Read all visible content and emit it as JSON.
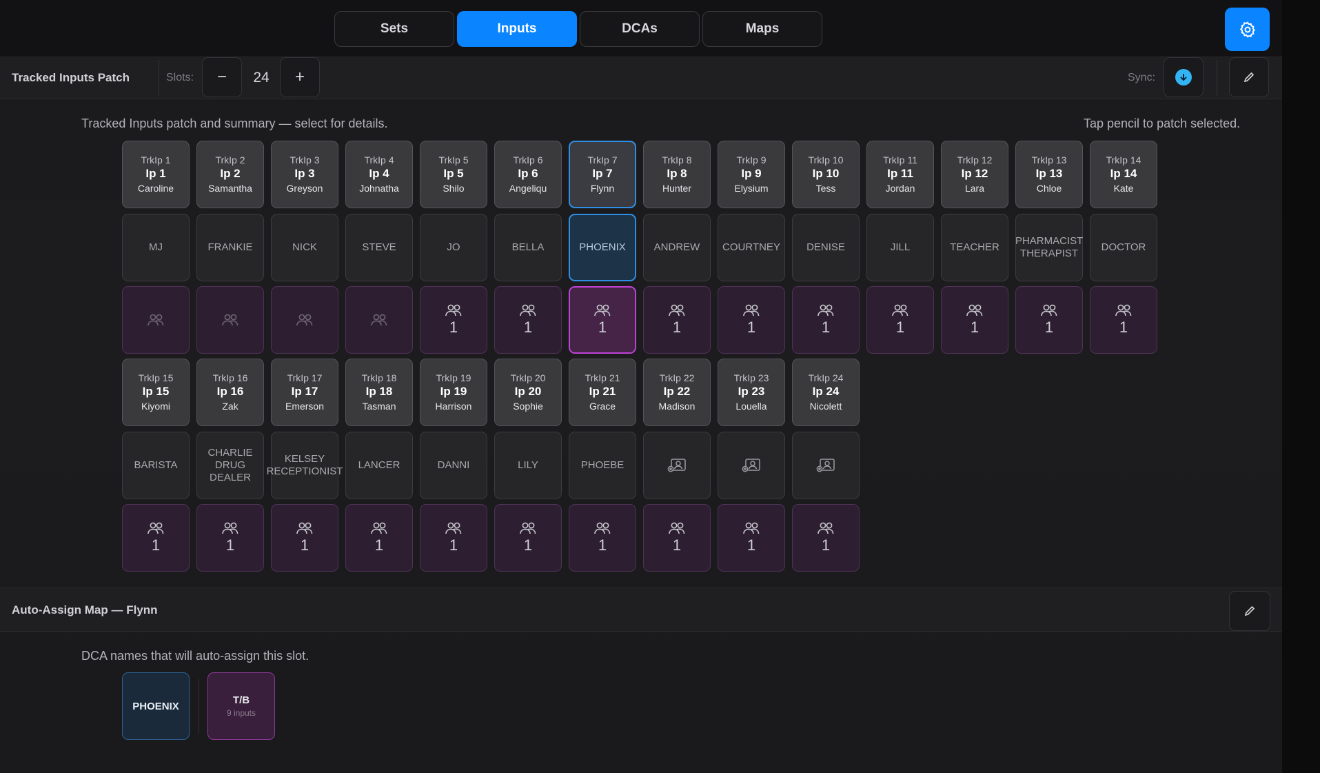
{
  "tabs": [
    {
      "label": "Sets",
      "active": false
    },
    {
      "label": "Inputs",
      "active": true
    },
    {
      "label": "DCAs",
      "active": false
    },
    {
      "label": "Maps",
      "active": false
    }
  ],
  "toolbar": {
    "title": "Tracked Inputs Patch",
    "slots_label": "Slots:",
    "minus": "−",
    "slots_value": "24",
    "plus": "+",
    "sync_label": "Sync:"
  },
  "patch": {
    "description": "Tracked Inputs patch and summary — select for details.",
    "hint": "Tap pencil to patch selected.",
    "slots": [
      {
        "trk": "TrkIp 1",
        "ip": "Ip 1",
        "who": "Caroline",
        "name": "MJ",
        "count": ""
      },
      {
        "trk": "TrkIp 2",
        "ip": "Ip 2",
        "who": "Samantha",
        "name": "FRANKIE",
        "count": ""
      },
      {
        "trk": "TrkIp 3",
        "ip": "Ip 3",
        "who": "Greyson",
        "name": "NICK",
        "count": ""
      },
      {
        "trk": "TrkIp 4",
        "ip": "Ip 4",
        "who": "Johnatha",
        "name": "STEVE",
        "count": ""
      },
      {
        "trk": "TrkIp 5",
        "ip": "Ip 5",
        "who": "Shilo",
        "name": "JO",
        "count": "1"
      },
      {
        "trk": "TrkIp 6",
        "ip": "Ip 6",
        "who": "Angeliqu",
        "name": "BELLA",
        "count": "1"
      },
      {
        "trk": "TrkIp 7",
        "ip": "Ip 7",
        "who": "Flynn",
        "name": "PHOENIX",
        "count": "1",
        "selected": true
      },
      {
        "trk": "TrkIp 8",
        "ip": "Ip 8",
        "who": "Hunter",
        "name": "ANDREW",
        "count": "1"
      },
      {
        "trk": "TrkIp 9",
        "ip": "Ip 9",
        "who": "Elysium",
        "name": "COURTNEY",
        "count": "1"
      },
      {
        "trk": "TrkIp 10",
        "ip": "Ip 10",
        "who": "Tess",
        "name": "DENISE",
        "count": "1"
      },
      {
        "trk": "TrkIp 11",
        "ip": "Ip 11",
        "who": "Jordan",
        "name": "JILL",
        "count": "1"
      },
      {
        "trk": "TrkIp 12",
        "ip": "Ip 12",
        "who": "Lara",
        "name": "TEACHER",
        "count": "1"
      },
      {
        "trk": "TrkIp 13",
        "ip": "Ip 13",
        "who": "Chloe",
        "name": "PHARMACIST THERAPIST",
        "count": "1"
      },
      {
        "trk": "TrkIp 14",
        "ip": "Ip 14",
        "who": "Kate",
        "name": "DOCTOR",
        "count": "1"
      },
      {
        "trk": "TrkIp 15",
        "ip": "Ip 15",
        "who": "Kiyomi",
        "name": "BARISTA",
        "count": "1"
      },
      {
        "trk": "TrkIp 16",
        "ip": "Ip 16",
        "who": "Zak",
        "name": "CHARLIE DRUG DEALER",
        "count": "1"
      },
      {
        "trk": "TrkIp 17",
        "ip": "Ip 17",
        "who": "Emerson",
        "name": "KELSEY RECEPTIONIST",
        "count": "1"
      },
      {
        "trk": "TrkIp 18",
        "ip": "Ip 18",
        "who": "Tasman",
        "name": "LANCER",
        "count": "1"
      },
      {
        "trk": "TrkIp 19",
        "ip": "Ip 19",
        "who": "Harrison",
        "name": "DANNI",
        "count": "1"
      },
      {
        "trk": "TrkIp 20",
        "ip": "Ip 20",
        "who": "Sophie",
        "name": "LILY",
        "count": "1"
      },
      {
        "trk": "TrkIp 21",
        "ip": "Ip 21",
        "who": "Grace",
        "name": "PHOEBE",
        "count": "1"
      },
      {
        "trk": "TrkIp 22",
        "ip": "Ip 22",
        "who": "Madison",
        "name": "",
        "count": "1"
      },
      {
        "trk": "TrkIp 23",
        "ip": "Ip 23",
        "who": "Louella",
        "name": "",
        "count": "1"
      },
      {
        "trk": "TrkIp 24",
        "ip": "Ip 24",
        "who": "Nicolett",
        "name": "",
        "count": "1"
      }
    ]
  },
  "auto_assign": {
    "title": "Auto-Assign Map — Flynn",
    "description": "DCA names that will auto-assign this slot.",
    "dca_phoenix": "PHOENIX",
    "dca_tb_name": "T/B",
    "dca_tb_sub": "9 inputs"
  },
  "colors": {
    "accent": "#0a84ff",
    "selected_pink": "#c043d6",
    "sync": "#33b4f5"
  },
  "icons": {
    "settings": "gear-icon",
    "sync": "download-circle-icon",
    "edit": "pencil-icon",
    "group": "people-icon",
    "assign": "assign-person-icon"
  }
}
